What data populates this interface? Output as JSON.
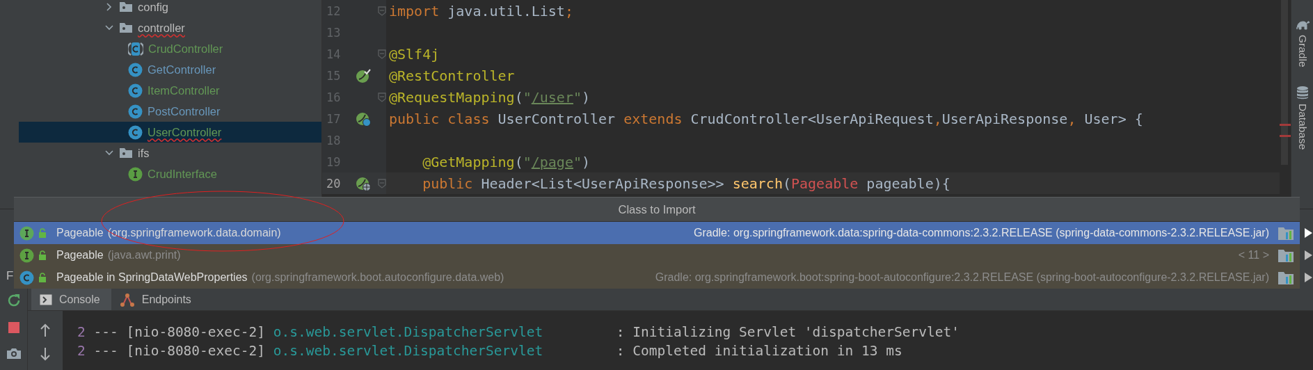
{
  "project_tree": {
    "items": [
      {
        "kind": "folder",
        "label": "config",
        "expanded": false,
        "selected": false,
        "color": "#bbbbbb",
        "error": false
      },
      {
        "kind": "folder",
        "label": "controller",
        "expanded": true,
        "selected": false,
        "color": "#bbbbbb",
        "error": true,
        "children": [
          {
            "kind": "abstract-class",
            "label": "CrudController",
            "selected": false,
            "color": "#629755",
            "error": false
          },
          {
            "kind": "class",
            "label": "GetController",
            "selected": false,
            "color": "#6897bb",
            "error": false
          },
          {
            "kind": "class",
            "label": "ItemController",
            "selected": false,
            "color": "#629755",
            "error": false
          },
          {
            "kind": "class",
            "label": "PostController",
            "selected": false,
            "color": "#6897bb",
            "error": false
          },
          {
            "kind": "class",
            "label": "UserController",
            "selected": true,
            "color": "#629755",
            "error": true
          }
        ]
      },
      {
        "kind": "folder",
        "label": "ifs",
        "expanded": true,
        "selected": false,
        "color": "#bbbbbb",
        "error": false,
        "children": [
          {
            "kind": "interface",
            "label": "CrudInterface",
            "selected": false,
            "color": "#629755",
            "error": false
          }
        ]
      }
    ]
  },
  "editor": {
    "lines": [
      {
        "number": "12",
        "kind": "plain",
        "fold": true,
        "current": false,
        "tokens": [
          {
            "kind": "keyword",
            "text": "import"
          },
          {
            "kind": "plain",
            "text": " java.util.List"
          },
          {
            "kind": "keyword",
            "text": ";"
          }
        ]
      },
      {
        "number": "13",
        "kind": "plain",
        "fold": false,
        "current": false
      },
      {
        "number": "14",
        "kind": "plain",
        "fold": true,
        "current": false,
        "tokens": [
          {
            "kind": "annotation",
            "text": "@Slf4j"
          }
        ]
      },
      {
        "number": "15",
        "fold": false,
        "current": false,
        "kind": "bean",
        "tokens": [
          {
            "kind": "annotation",
            "text": "@RestController"
          }
        ]
      },
      {
        "number": "16",
        "kind": "plain",
        "fold": true,
        "current": false,
        "tokens": [
          {
            "kind": "annotation",
            "text": "@RequestMapping"
          },
          {
            "kind": "plain",
            "text": "("
          },
          {
            "kind": "string",
            "text": "\""
          },
          {
            "kind": "link",
            "text": "/user"
          },
          {
            "kind": "string",
            "text": "\""
          },
          {
            "kind": "plain",
            "text": ")"
          }
        ]
      },
      {
        "number": "17",
        "fold": false,
        "current": false,
        "kind": "bean-class",
        "tokens": [
          {
            "kind": "keyword",
            "text": "public class "
          },
          {
            "kind": "plain",
            "text": "UserController "
          },
          {
            "kind": "keyword",
            "text": "extends "
          },
          {
            "kind": "plain",
            "text": "CrudController<UserApiRequest"
          },
          {
            "kind": "keyword",
            "text": ","
          },
          {
            "kind": "plain",
            "text": "UserApiResponse"
          },
          {
            "kind": "keyword",
            "text": ","
          },
          {
            "kind": "plain",
            "text": " User> {"
          }
        ]
      },
      {
        "number": "18",
        "kind": "plain",
        "fold": false,
        "current": false
      },
      {
        "number": "19",
        "kind": "plain",
        "fold": false,
        "current": false,
        "tokens": [
          {
            "kind": "annotation",
            "text": "    @GetMapping"
          },
          {
            "kind": "plain",
            "text": "("
          },
          {
            "kind": "string",
            "text": "\""
          },
          {
            "kind": "link",
            "text": "/page"
          },
          {
            "kind": "string",
            "text": "\""
          },
          {
            "kind": "plain",
            "text": ")"
          }
        ]
      },
      {
        "number": "20",
        "fold": true,
        "current": true,
        "kind": "bean-web",
        "tokens": [
          {
            "kind": "keyword",
            "text": "    public "
          },
          {
            "kind": "plain",
            "text": "Header<List<UserApiResponse>> "
          },
          {
            "kind": "method",
            "text": "search"
          },
          {
            "kind": "plain",
            "text": "("
          },
          {
            "kind": "unresolved",
            "text": "Pageable"
          },
          {
            "kind": "plain",
            "text": " pageable){"
          }
        ]
      }
    ]
  },
  "right_toolbar": {
    "items": [
      {
        "kind": "gradle",
        "label": "Gradle"
      },
      {
        "kind": "database",
        "label": "Database"
      }
    ]
  },
  "import_popup": {
    "title": "Class to Import",
    "rows": [
      {
        "kind": "interface",
        "name": "Pageable",
        "package": "(org.springframework.data.domain)",
        "location": "Gradle: org.springframework.data:spring-data-commons:2.3.2.RELEASE (spring-data-commons-2.3.2.RELEASE.jar)",
        "selected": true
      },
      {
        "kind": "interface",
        "name": "Pageable",
        "package": "(java.awt.print)",
        "location": "< 11 >",
        "selected": false
      },
      {
        "kind": "class",
        "name": "Pageable in SpringDataWebProperties",
        "package": "(org.springframework.boot.autoconfigure.data.web)",
        "location": "Gradle: org.springframework.boot:spring-boot-autoconfigure:2.3.2.RELEASE (spring-boot-autoconfigure-2.3.2.RELEASE.jar)",
        "selected": false
      }
    ]
  },
  "run_panel": {
    "title": "F",
    "tabs": [
      {
        "label": "Console",
        "kind": "console",
        "selected": true
      },
      {
        "label": "Endpoints",
        "kind": "endpoints",
        "selected": false
      }
    ],
    "console_lines": [
      {
        "count": "2",
        "thread": "--- [nio-8080-exec-2]",
        "logger": "o.s.web.servlet.DispatcherServlet",
        "message": ": Initializing Servlet 'dispatcherServlet'"
      },
      {
        "count": "2",
        "thread": "--- [nio-8080-exec-2]",
        "logger": "o.s.web.servlet.DispatcherServlet",
        "message": ": Completed initialization in 13 ms"
      }
    ]
  }
}
